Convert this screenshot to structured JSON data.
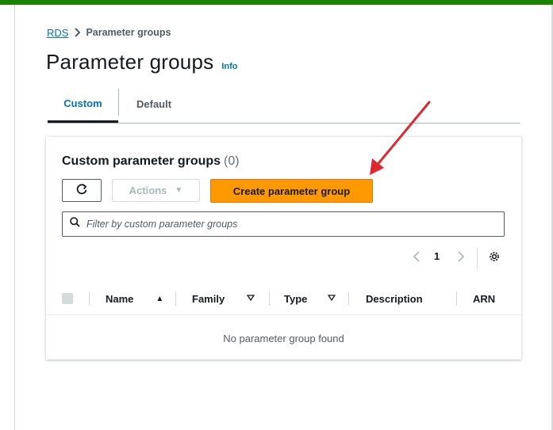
{
  "breadcrumb": {
    "root": "RDS",
    "current": "Parameter groups"
  },
  "page": {
    "title": "Parameter groups",
    "info": "Info"
  },
  "tabs": [
    {
      "label": "Custom",
      "selected": true
    },
    {
      "label": "Default",
      "selected": false
    }
  ],
  "panel": {
    "title": "Custom parameter groups",
    "count": "(0)",
    "actions_label": "Actions",
    "create_label": "Create parameter group",
    "filter_placeholder": "Filter by custom parameter groups",
    "page_number": "1"
  },
  "table": {
    "columns": [
      "Name",
      "Family",
      "Type",
      "Description",
      "ARN"
    ],
    "empty_text": "No parameter group found"
  },
  "colors": {
    "accent_green": "#1d8102",
    "link_blue": "#0073bb",
    "primary_orange": "#ff9900",
    "annotation_red": "#e0262e"
  }
}
